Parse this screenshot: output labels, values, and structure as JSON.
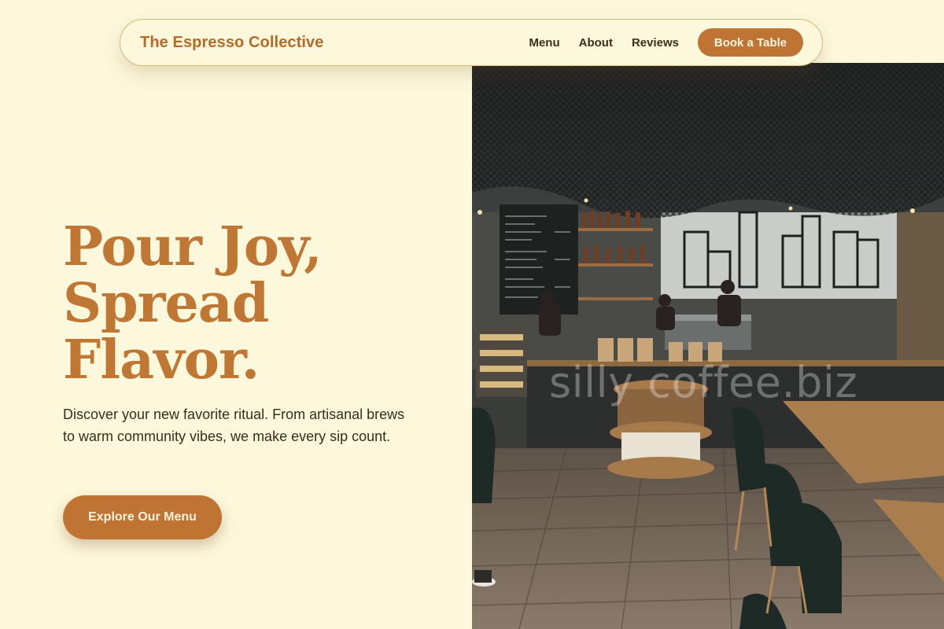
{
  "nav": {
    "brand": "The Espresso Collective",
    "links": [
      {
        "label": "Menu"
      },
      {
        "label": "About"
      },
      {
        "label": "Reviews"
      }
    ],
    "cta_label": "Book a Table"
  },
  "hero": {
    "title_lines": [
      "Pour Joy,",
      "Spread",
      "Flavor."
    ],
    "subtitle": "Discover your new favorite ritual. From artisanal brews to warm community vibes, we make every sip count.",
    "cta_label": "Explore Our Menu",
    "image_watermark": "silly coffee.biz"
  },
  "colors": {
    "background": "#fdf8dc",
    "accent": "#bf7433",
    "heading": "#c07733",
    "text": "#3b2c1d"
  }
}
